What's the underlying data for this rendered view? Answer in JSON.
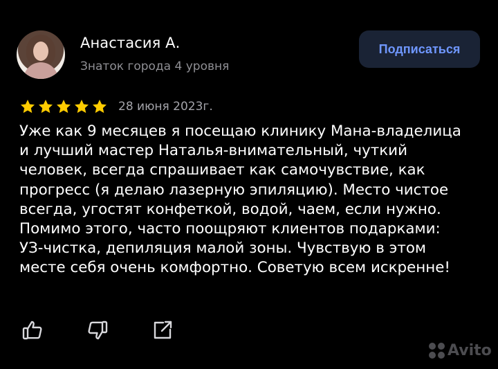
{
  "reviewer": {
    "name": "Анастасия А.",
    "subtitle": "Знаток города 4 уровня"
  },
  "subscribe_button": "Подписаться",
  "rating": {
    "stars_filled": 5,
    "stars_total": 5,
    "date": "28 июня 2023г."
  },
  "review_text": "Уже как 9 месяцев я посещаю клинику Мана-владелица\nи лучший мастер Наталья-внимательный, чуткий\nчеловек, всегда спрашивает как самочувствие, как\nпрогресс (я делаю лазерную эпиляцию). Место чистое\nвсегда, угостят конфеткой, водой, чаем, если нужно.\nПомимо этого, часто поощряют клиентов подарками:\nУЗ-чистка, депиляция малой зоны. Чувствую в этом\nместе себя очень комфортно. Советую всем искренне!",
  "icons": {
    "like": "thumbs-up-icon",
    "dislike": "thumbs-down-icon",
    "share": "share-icon",
    "star": "star-icon"
  },
  "watermark": {
    "text": "Avito"
  },
  "colors": {
    "background": "#000000",
    "star": "#ffcc00",
    "subscribe_bg": "#1a2335",
    "subscribe_text": "#6f97ff",
    "muted_text": "#8f8f94"
  }
}
